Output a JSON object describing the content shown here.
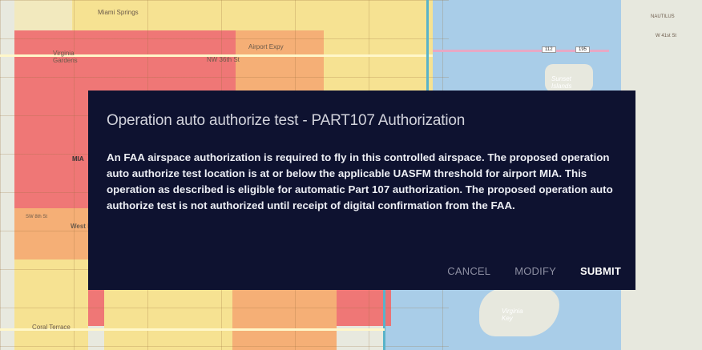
{
  "map": {
    "labels": {
      "miami_springs": "Miami Springs",
      "virginia_gardens": "Virginia\nGardens",
      "nw_36th": "NW 36th St",
      "airport_expy": "Airport Expy",
      "sunset_islands": "Sunset\nIslands",
      "west_flagler": "West F",
      "sw_8th": "SW 8th St",
      "coral_terrace": "Coral Terrace",
      "virginia_key": "Virginia\nKey",
      "mia_partial": "MIA",
      "nautilus": "NAUTILUS",
      "w_41st": "W 41st St",
      "road_112": "112",
      "road_195": "195"
    }
  },
  "dialog": {
    "title": "Operation auto authorize test - PART107 Authorization",
    "body": "An FAA airspace authorization is required to fly in this controlled airspace. The proposed operation auto authorize test location is at or below the applicable UASFM threshold for airport MIA. This operation as described is eligible for automatic Part 107 authorization. The proposed operation auto authorize test is not authorized until receipt of digital confirmation from the FAA.",
    "buttons": {
      "cancel": "CANCEL",
      "modify": "MODIFY",
      "submit": "SUBMIT"
    }
  }
}
